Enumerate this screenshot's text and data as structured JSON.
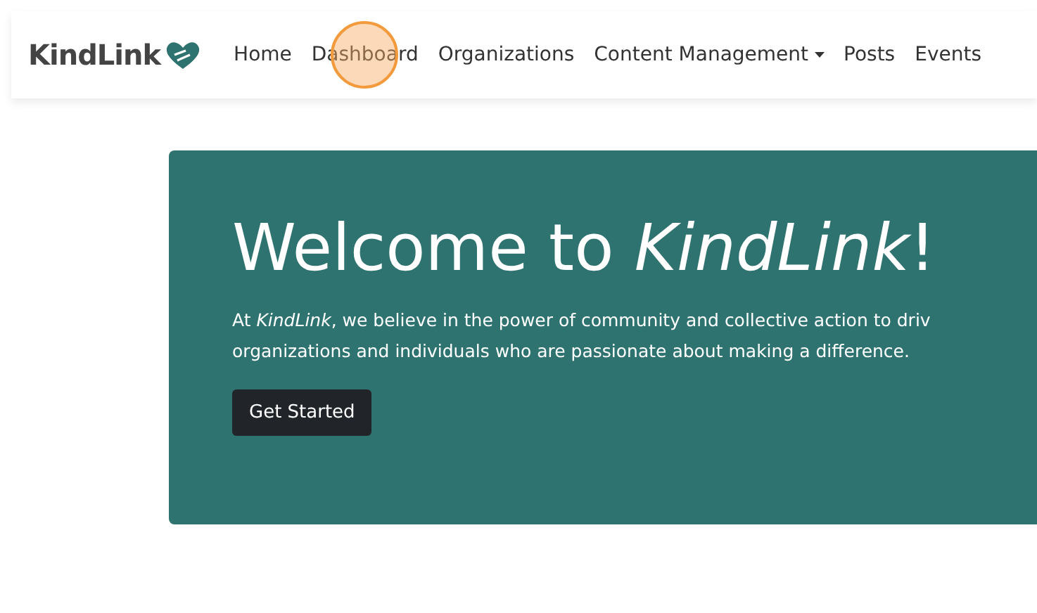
{
  "navbar": {
    "logo": "KindLink",
    "links": [
      {
        "label": "Home",
        "dropdown": false,
        "clicked": false
      },
      {
        "label": "Dashboard",
        "dropdown": false,
        "clicked": true
      },
      {
        "label": "Organizations",
        "dropdown": false,
        "clicked": false
      },
      {
        "label": "Content Management",
        "dropdown": true,
        "clicked": false
      },
      {
        "label": "Posts",
        "dropdown": false,
        "clicked": false
      },
      {
        "label": "Events",
        "dropdown": false,
        "clicked": false
      }
    ]
  },
  "hero": {
    "title": "Welcome to *KindLink*!",
    "lines": [
      "At *KindLink*, we believe in the power of community and collective action to driv",
      "organizations and individuals who are passionate about making a difference."
    ],
    "button": "Get Started"
  }
}
